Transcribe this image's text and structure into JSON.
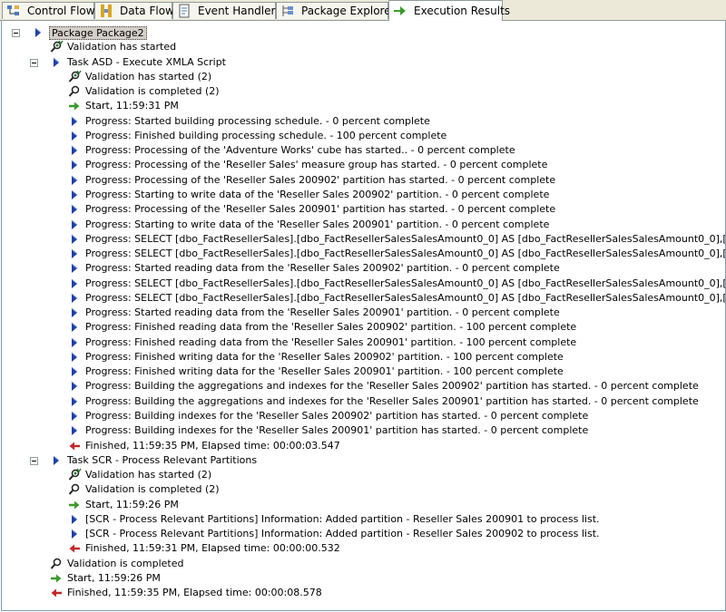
{
  "tabs": [
    {
      "label": "Control Flow",
      "icon": "control-flow-icon",
      "active": false
    },
    {
      "label": "Data Flow",
      "icon": "data-flow-icon",
      "active": false
    },
    {
      "label": "Event Handlers",
      "icon": "event-handlers-icon",
      "active": false
    },
    {
      "label": "Package Explorer",
      "icon": "package-explorer-icon",
      "active": false
    },
    {
      "label": "Execution Results",
      "icon": "execution-results-icon",
      "active": true
    }
  ],
  "colors": {
    "progress_arrow": "#1f3fa8",
    "start_arrow": "#3a9a2a",
    "finish_arrow": "#c0282a",
    "validation": "#2e7d32"
  },
  "rows": [
    {
      "text": "Package Package2",
      "icon": "package-icon",
      "level": 0,
      "expander": true,
      "selected": true
    },
    {
      "text": "Validation has started",
      "icon": "validation-started-icon",
      "level": 1
    },
    {
      "text": "Task ASD - Execute XMLA Script",
      "icon": "task-icon",
      "level": 1,
      "expander": true
    },
    {
      "text": "Validation has started (2)",
      "icon": "validation-started-icon",
      "level": 2
    },
    {
      "text": "Validation is completed (2)",
      "icon": "validation-completed-icon",
      "level": 2
    },
    {
      "text": "Start, 11:59:31 PM",
      "icon": "start-icon",
      "level": 2
    },
    {
      "text": "Progress: Started building processing schedule. - 0 percent complete",
      "icon": "progress-icon",
      "level": 2
    },
    {
      "text": "Progress: Finished building processing schedule. - 100 percent complete",
      "icon": "progress-icon",
      "level": 2
    },
    {
      "text": "Progress: Processing of the 'Adventure Works' cube has started.. - 0 percent complete",
      "icon": "progress-icon",
      "level": 2
    },
    {
      "text": "Progress: Processing of the 'Reseller Sales' measure group has started. - 0 percent complete",
      "icon": "progress-icon",
      "level": 2
    },
    {
      "text": "Progress: Processing of the 'Reseller Sales 200902' partition has started. - 0 percent complete",
      "icon": "progress-icon",
      "level": 2
    },
    {
      "text": "Progress: Starting to write data of the 'Reseller Sales 200902' partition. - 0 percent complete",
      "icon": "progress-icon",
      "level": 2
    },
    {
      "text": "Progress: Processing of the 'Reseller Sales 200901' partition has started. - 0 percent complete",
      "icon": "progress-icon",
      "level": 2
    },
    {
      "text": "Progress: Starting to write data of the 'Reseller Sales 200901' partition. - 0 percent complete",
      "icon": "progress-icon",
      "level": 2
    },
    {
      "text": "Progress:  SELECT [dbo_FactResellerSales].[dbo_FactResellerSalesSalesAmount0_0] AS [dbo_FactResellerSalesSalesAmount0_0],[dbo_FactR",
      "icon": "progress-icon",
      "level": 2
    },
    {
      "text": "Progress:  SELECT [dbo_FactResellerSales].[dbo_FactResellerSalesSalesAmount0_0] AS [dbo_FactResellerSalesSalesAmount0_0],[dbo_FactR",
      "icon": "progress-icon",
      "level": 2
    },
    {
      "text": "Progress: Started reading data from the 'Reseller Sales 200902' partition. - 0 percent complete",
      "icon": "progress-icon",
      "level": 2
    },
    {
      "text": "Progress:  SELECT [dbo_FactResellerSales].[dbo_FactResellerSalesSalesAmount0_0] AS [dbo_FactResellerSalesSalesAmount0_0],[dbo_FactR",
      "icon": "progress-icon",
      "level": 2
    },
    {
      "text": "Progress:  SELECT [dbo_FactResellerSales].[dbo_FactResellerSalesSalesAmount0_0] AS [dbo_FactResellerSalesSalesAmount0_0],[dbo_FactR",
      "icon": "progress-icon",
      "level": 2
    },
    {
      "text": "Progress: Started reading data from the 'Reseller Sales 200901' partition. - 0 percent complete",
      "icon": "progress-icon",
      "level": 2
    },
    {
      "text": "Progress: Finished reading data from the 'Reseller Sales 200902' partition. - 100 percent complete",
      "icon": "progress-icon",
      "level": 2
    },
    {
      "text": "Progress: Finished reading data from the 'Reseller Sales 200901' partition. - 100 percent complete",
      "icon": "progress-icon",
      "level": 2
    },
    {
      "text": "Progress: Finished writing data for the 'Reseller Sales 200902' partition. - 100 percent complete",
      "icon": "progress-icon",
      "level": 2
    },
    {
      "text": "Progress: Finished writing data for the 'Reseller Sales 200901' partition. - 100 percent complete",
      "icon": "progress-icon",
      "level": 2
    },
    {
      "text": "Progress: Building the aggregations and indexes for the 'Reseller Sales 200902' partition has started. - 0 percent complete",
      "icon": "progress-icon",
      "level": 2
    },
    {
      "text": "Progress: Building the aggregations and indexes for the 'Reseller Sales 200901' partition has started. - 0 percent complete",
      "icon": "progress-icon",
      "level": 2
    },
    {
      "text": "Progress: Building indexes for the 'Reseller Sales 200902' partition has started. - 0 percent complete",
      "icon": "progress-icon",
      "level": 2
    },
    {
      "text": "Progress: Building indexes for the 'Reseller Sales 200901' partition has started. - 0 percent complete",
      "icon": "progress-icon",
      "level": 2
    },
    {
      "text": "Finished, 11:59:35 PM, Elapsed time: 00:00:03.547",
      "icon": "finished-icon",
      "level": 2
    },
    {
      "text": "Task SCR - Process Relevant Partitions",
      "icon": "task-icon",
      "level": 1,
      "expander": true
    },
    {
      "text": "Validation has started (2)",
      "icon": "validation-started-icon",
      "level": 2
    },
    {
      "text": "Validation is completed (2)",
      "icon": "validation-completed-icon",
      "level": 2
    },
    {
      "text": "Start, 11:59:26 PM",
      "icon": "start-icon",
      "level": 2
    },
    {
      "text": "[SCR - Process Relevant Partitions] Information: Added partition - Reseller Sales 200901 to process list.",
      "icon": "progress-icon",
      "level": 2
    },
    {
      "text": "[SCR - Process Relevant Partitions] Information: Added partition - Reseller Sales 200902 to process list.",
      "icon": "progress-icon",
      "level": 2
    },
    {
      "text": "Finished, 11:59:31 PM, Elapsed time: 00:00:00.532",
      "icon": "finished-icon",
      "level": 2
    },
    {
      "text": "Validation is completed",
      "icon": "validation-completed-icon",
      "level": 1
    },
    {
      "text": "Start, 11:59:26 PM",
      "icon": "start-icon",
      "level": 1
    },
    {
      "text": "Finished, 11:59:35 PM, Elapsed time: 00:00:08.578",
      "icon": "finished-icon",
      "level": 1
    }
  ]
}
